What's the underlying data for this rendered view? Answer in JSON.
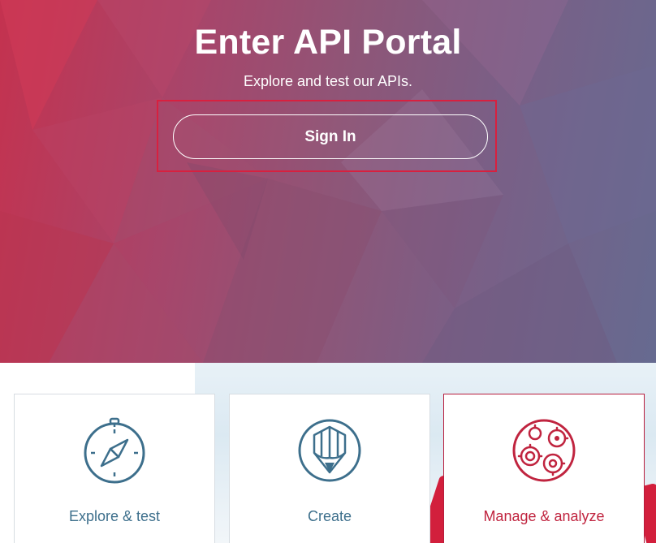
{
  "hero": {
    "title": "Enter API Portal",
    "subtitle": "Explore and test our APIs.",
    "signin_label": "Sign In"
  },
  "cards": [
    {
      "label": "Explore & test",
      "icon": "compass-icon",
      "color": "#3d6f8c"
    },
    {
      "label": "Create",
      "icon": "pencil-shield-icon",
      "color": "#3d6f8c"
    },
    {
      "label": "Manage & analyze",
      "icon": "gears-globe-icon",
      "color": "#c0243f"
    }
  ],
  "colors": {
    "accent_red": "#d8203f",
    "icon_blue": "#3d6f8c",
    "icon_red": "#c0243f"
  }
}
